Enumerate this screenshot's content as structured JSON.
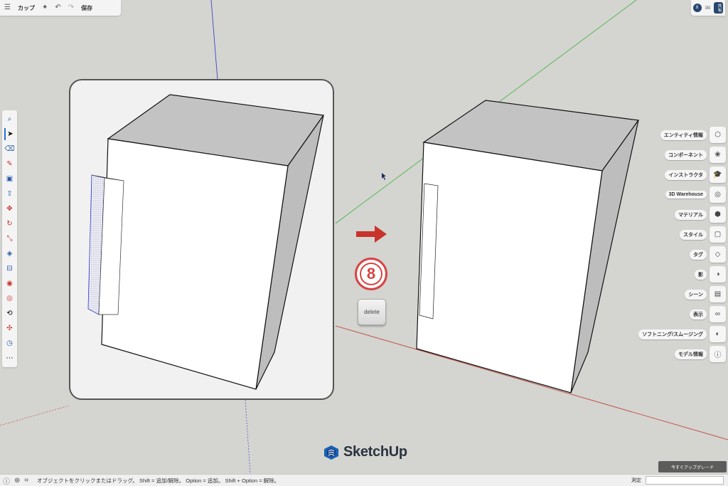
{
  "toolbar": {
    "menu_icon": "hamburger-icon",
    "title": "カップ",
    "save_label": "保存"
  },
  "user": {
    "avatar_initial": "8",
    "share_label": "共有"
  },
  "left_tools": [
    {
      "name": "search-tool",
      "glyph": "⌕"
    },
    {
      "name": "select-tool",
      "glyph": "➤"
    },
    {
      "name": "eraser-tool",
      "glyph": "⌫"
    },
    {
      "name": "pencil-tool",
      "glyph": "✎"
    },
    {
      "name": "rectangle-tool",
      "glyph": "▣"
    },
    {
      "name": "push-pull-tool",
      "glyph": "⇪"
    },
    {
      "name": "move-tool",
      "glyph": "✥"
    },
    {
      "name": "rotate-tool",
      "glyph": "↻"
    },
    {
      "name": "scale-tool",
      "glyph": "⤡"
    },
    {
      "name": "paint-bucket-tool",
      "glyph": "◈"
    },
    {
      "name": "tape-measure-tool",
      "glyph": "⊟"
    },
    {
      "name": "section-plane-tool",
      "glyph": "◉"
    },
    {
      "name": "orbit-tool",
      "glyph": "◎"
    },
    {
      "name": "pan-tool",
      "glyph": "⟲"
    },
    {
      "name": "walk-tool",
      "glyph": "✣"
    },
    {
      "name": "compass-tool",
      "glyph": "◷"
    },
    {
      "name": "more-tools",
      "glyph": "⋯"
    }
  ],
  "right_panel": [
    {
      "label": "エンティティ情報",
      "icon": "⬡"
    },
    {
      "label": "コンポーネント",
      "icon": "❀"
    },
    {
      "label": "インストラクタ",
      "icon": "🎓"
    },
    {
      "label": "3D Warehouse",
      "icon": "◎"
    },
    {
      "label": "マテリアル",
      "icon": "⬢"
    },
    {
      "label": "スタイル",
      "icon": "▢"
    },
    {
      "label": "タグ",
      "icon": "◇"
    },
    {
      "label": "影",
      "icon": "◑"
    },
    {
      "label": "シーン",
      "icon": "▤"
    },
    {
      "label": "表示",
      "icon": "∞"
    },
    {
      "label": "ソフトニング/スムージング",
      "icon": "◐"
    },
    {
      "label": "モデル情報",
      "icon": "ⓘ"
    }
  ],
  "keystroke": {
    "step_number": "8",
    "key_label": "delete"
  },
  "branding": {
    "word": "SketchUp"
  },
  "upgrade_label": "今すぐアップグレード",
  "status": {
    "message": "オブジェクトをクリックまたはドラッグ。 Shift = 追加/解除。 Option = 追加。 Shift + Option = 解除。",
    "measure_label": "測定",
    "measure_value": ""
  },
  "colors": {
    "axis_blue": "#2a36c8",
    "axis_green": "#3cb43c",
    "axis_red": "#c0392b",
    "background": "#d4d4d0",
    "accent_red": "#d64545",
    "brand_navy": "#27466c"
  }
}
